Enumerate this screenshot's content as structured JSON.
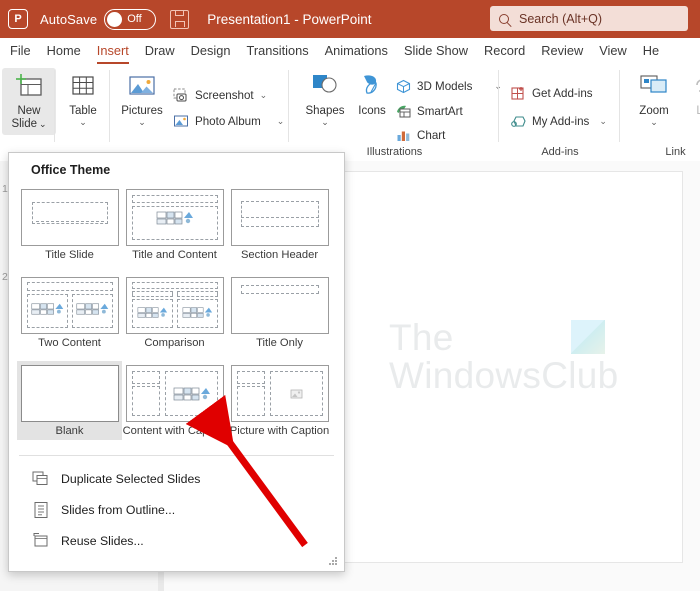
{
  "titlebar": {
    "app_icon": "powerpoint-logo-icon",
    "logo_letter": "P",
    "autosave_label": "AutoSave",
    "autosave_state": "Off",
    "save_icon": "save-icon",
    "document_title": "Presentation1  -  PowerPoint",
    "bar_color": "#b7472a"
  },
  "search": {
    "icon": "search-icon",
    "placeholder": "Search (Alt+Q)"
  },
  "tabs": [
    {
      "label": "File",
      "active": false
    },
    {
      "label": "Home",
      "active": false
    },
    {
      "label": "Insert",
      "active": true
    },
    {
      "label": "Draw",
      "active": false
    },
    {
      "label": "Design",
      "active": false
    },
    {
      "label": "Transitions",
      "active": false
    },
    {
      "label": "Animations",
      "active": false
    },
    {
      "label": "Slide Show",
      "active": false
    },
    {
      "label": "Record",
      "active": false
    },
    {
      "label": "Review",
      "active": false
    },
    {
      "label": "View",
      "active": false
    },
    {
      "label": "He",
      "active": false
    }
  ],
  "ribbon": {
    "new_slide": {
      "line1": "New",
      "line2": "Slide",
      "caret": "⌄",
      "icon": "new-slide-icon"
    },
    "table": {
      "label": "Table",
      "caret": "⌄",
      "icon": "table-icon"
    },
    "pictures": {
      "label": "Pictures",
      "caret": "⌄",
      "icon": "pictures-icon"
    },
    "screenshot": {
      "label": "Screenshot",
      "caret": "⌄",
      "icon": "screenshot-icon"
    },
    "photo_album": {
      "label": "Photo Album",
      "caret": "⌄",
      "icon": "photo-album-icon"
    },
    "shapes": {
      "label": "Shapes",
      "caret": "⌄",
      "icon": "shapes-icon"
    },
    "icons_btn": {
      "label": "Icons",
      "icon": "icons-icon"
    },
    "models3d": {
      "label": "3D Models",
      "caret": "⌄",
      "icon": "3d-models-icon"
    },
    "smartart": {
      "label": "SmartArt",
      "icon": "smartart-icon"
    },
    "chart": {
      "label": "Chart",
      "icon": "chart-icon"
    },
    "get_addins": {
      "label": "Get Add-ins",
      "icon": "get-addins-icon"
    },
    "my_addins": {
      "label": "My Add-ins",
      "caret": "⌄",
      "icon": "my-addins-icon"
    },
    "zoom_btn": {
      "label": "Zoom",
      "caret": "⌄",
      "icon": "zoom-icon"
    },
    "link_btn": {
      "label": "Lin",
      "caret": "⌄",
      "icon": "link-icon"
    },
    "group_labels": {
      "illustrations": "Illustrations",
      "addins": "Add-ins",
      "links": "Link"
    }
  },
  "slide_panel": {
    "slide_numbers": [
      "1",
      "2"
    ]
  },
  "canvas": {
    "watermark_line1": "The",
    "watermark_line2": "WindowsClub"
  },
  "dropdown": {
    "section_title": "Office Theme",
    "layouts": [
      {
        "name": "Title Slide",
        "selected": false,
        "kind": "title-slide"
      },
      {
        "name": "Title and Content",
        "selected": false,
        "kind": "title-and-content"
      },
      {
        "name": "Section Header",
        "selected": false,
        "kind": "section-header"
      },
      {
        "name": "Two Content",
        "selected": false,
        "kind": "two-content"
      },
      {
        "name": "Comparison",
        "selected": false,
        "kind": "comparison"
      },
      {
        "name": "Title Only",
        "selected": false,
        "kind": "title-only"
      },
      {
        "name": "Blank",
        "selected": true,
        "kind": "blank"
      },
      {
        "name": "Content with Caption",
        "selected": false,
        "kind": "content-with-caption"
      },
      {
        "name": "Picture with Caption",
        "selected": false,
        "kind": "picture-with-caption"
      }
    ],
    "menu_items": [
      {
        "label": "Duplicate Selected Slides",
        "accel": "D",
        "icon": "duplicate-slides-icon"
      },
      {
        "label": "Slides from Outline...",
        "accel": "i",
        "icon": "slides-from-outline-icon"
      },
      {
        "label": "Reuse Slides...",
        "accel": "R",
        "icon": "reuse-slides-icon"
      }
    ]
  },
  "annotation": {
    "arrow_color": "#e00000",
    "arrow_from": "305,545",
    "arrow_to": "215,424"
  }
}
